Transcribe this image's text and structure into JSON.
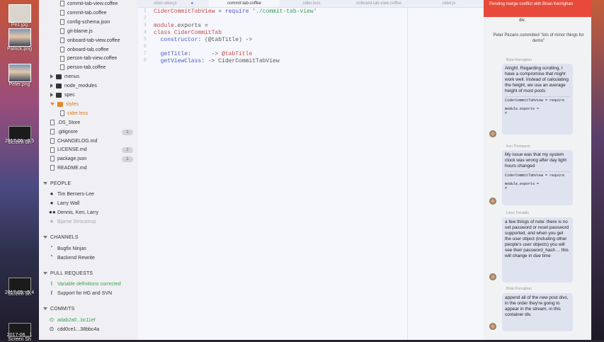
{
  "desktop": {
    "icons": [
      {
        "label": "Pez.jpg",
        "kind": "photo"
      },
      {
        "label": "Patrick.png",
        "kind": "face"
      },
      {
        "label": "Peter.png",
        "kind": "face"
      },
      {
        "label": "Screen Sh",
        "kind": "screen"
      },
      {
        "label": "2017-06...3.5",
        "kind": "none"
      },
      {
        "label": "Screen Sh",
        "kind": "screen"
      },
      {
        "label": "2017-05...5.4",
        "kind": "none"
      },
      {
        "label": "Screen Sh",
        "kind": "screen"
      },
      {
        "label": "2017-06...1",
        "kind": "none"
      }
    ]
  },
  "sidebar": {
    "tree": [
      {
        "label": "commit-tab-view.coffee",
        "type": "file",
        "indent": 2
      },
      {
        "label": "commit-tab.coffee",
        "type": "file",
        "indent": 2
      },
      {
        "label": "config-schema.json",
        "type": "file",
        "indent": 2
      },
      {
        "label": "git-blame.js",
        "type": "file",
        "indent": 2
      },
      {
        "label": "onboard-tab-view.coffee",
        "type": "file",
        "indent": 2
      },
      {
        "label": "onboard-tab.coffee",
        "type": "file",
        "indent": 2
      },
      {
        "label": "person-tab-view.coffee",
        "type": "file",
        "indent": 2
      },
      {
        "label": "person-tab.coffee",
        "type": "file",
        "indent": 2
      },
      {
        "label": "menus",
        "type": "folder",
        "indent": 1
      },
      {
        "label": "node_modules",
        "type": "folder",
        "indent": 1
      },
      {
        "label": "spec",
        "type": "folder",
        "indent": 1
      },
      {
        "label": "styles",
        "type": "folder-open",
        "indent": 1
      },
      {
        "label": "cider.less",
        "type": "file-orange",
        "indent": 2
      },
      {
        "label": ".DS_Store",
        "type": "file",
        "indent": 1
      },
      {
        "label": ".gitignore",
        "type": "file",
        "indent": 1,
        "badge": "1"
      },
      {
        "label": "CHANGELOG.md",
        "type": "file",
        "indent": 1
      },
      {
        "label": "LICENSE.md",
        "type": "file",
        "indent": 1,
        "badge": "1"
      },
      {
        "label": "package.json",
        "type": "file",
        "indent": 1,
        "badge": "1"
      },
      {
        "label": "README.md",
        "type": "file",
        "indent": 1
      }
    ],
    "people_title": "PEOPLE",
    "people": [
      "Tim Berners-Lee",
      "Larry Wall",
      "Dennis, Ken, Larry",
      "Bjarne Stroustrup"
    ],
    "channels_title": "CHANNELS",
    "channels": [
      "Bugfix Ninjas",
      "Backend Rewrite"
    ],
    "pulls_title": "PULL REQUESTS",
    "pulls": [
      "Variable definitions corrected",
      "Support for HG and SVN"
    ],
    "commits_title": "COMMITS",
    "commits": [
      "adab2a0...bc11ef",
      "cdd0ce1...38bbc4a"
    ]
  },
  "editor": {
    "tabs": [
      "cider-view.js",
      "commit-tab.coffee",
      "cider.less",
      "onboard-tab-view.coffee",
      "cider.js"
    ],
    "active_tab": 1,
    "code": {
      "l1_a": "CiderCommitTabView",
      "l1_b": " = ",
      "l1_c": "require",
      "l1_d": " './commit-tab-view'",
      "l3_a": "module",
      "l3_b": ".exports =",
      "l4_a": "class ",
      "l4_b": "CiderCommitTab",
      "l5_a": "  constructor",
      "l5_b": ": (@tabTitle) ->",
      "l7_a": "  getTitle",
      "l7_b": ":      -> ",
      "l7_c": "@tabTitle",
      "l8_a": "  getViewClass",
      "l8_b": ": -> CiderCommitTabView"
    },
    "line_numbers": [
      "1",
      "2",
      "3",
      "4",
      "5",
      "6",
      "7",
      "8"
    ]
  },
  "panel": {
    "header": "Pending merge conflict with Brian Kernighan",
    "system_msg": "Peter Pezaris committed \"lots of minor things for demo\"",
    "top_fragment": "div.",
    "messages": [
      {
        "author": "Brian Kernighan",
        "text": "Alright. Regarding scrolling, I have a compromise that might work well. Instead of calculating the height, we use an average height of most posts",
        "code": "CiderCommitTabView = require\n\nmodule.exports =\n#"
      },
      {
        "author": "Ken Thompson",
        "text": "My issue was that my system clock was wrong after day light hours changed",
        "code": "CiderCommitTabView = require\n\nmodule.exports =\n#"
      },
      {
        "author": "Linus Torvalds",
        "text": "a few things of note: there is no set password or reset password supported, and when you get the user object (including other people's user objects) you will see their password_hash ... this will change in due time",
        "code": ""
      },
      {
        "author": "Brian Kernighan",
        "text": "append all of the new post divs, in the order they're going to appear in the stream, in this container div.",
        "code": ""
      }
    ]
  },
  "colors": {
    "accent": "#e74a3b",
    "link": "#4b5ac4",
    "green": "#3aa34b"
  }
}
